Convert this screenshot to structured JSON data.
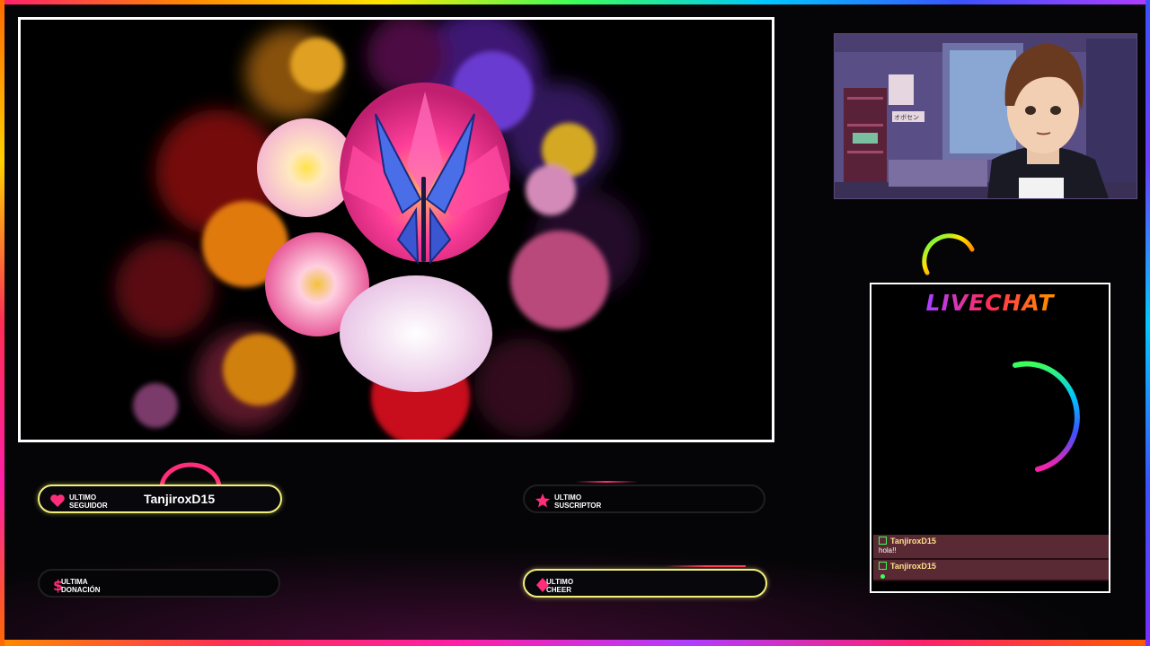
{
  "overlay": {
    "accent_colors": [
      "#ff1f6e",
      "#ff8a00",
      "#ffe600",
      "#3cff5a",
      "#00c8ff",
      "#3a52ff",
      "#b13cff"
    ],
    "frame_border_color": "#ffffff"
  },
  "main_scene": {
    "subject": "flower bouquet with blue butterfly"
  },
  "webcam": {
    "avatar": "anime-boy-avatar",
    "room_sign": "オボセン"
  },
  "chat": {
    "title": "LIVECHAT",
    "messages": [
      {
        "user": "TanjiroxD15",
        "text": "hola!!"
      },
      {
        "user": "TanjiroxD15",
        "text": ""
      }
    ]
  },
  "alerts": {
    "follower": {
      "label_line1": "ULTIMO",
      "label_line2": "SEGUIDOR",
      "value": "TanjiroxD15",
      "icon": "heart-icon",
      "color": "#ff2d7a"
    },
    "subscriber": {
      "label_line1": "ULTIMO",
      "label_line2": "SUSCRIPTOR",
      "value": "",
      "icon": "star-icon",
      "color": "#ff2d7a"
    },
    "donation": {
      "label_line1": "ULTIMA",
      "label_line2": "DONACIÓN",
      "value": "",
      "icon": "dollar-icon",
      "color": "#ff2d7a"
    },
    "cheer": {
      "label_line1": "ULTIMO",
      "label_line2": "CHEER",
      "value": "",
      "icon": "diamond-icon",
      "color": "#ff2d7a"
    }
  }
}
